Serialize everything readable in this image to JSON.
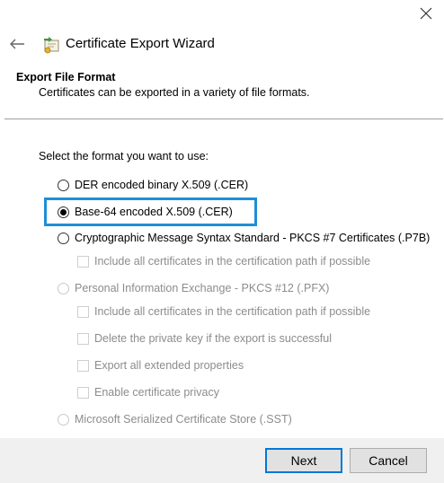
{
  "window": {
    "title": "Certificate Export Wizard",
    "close_icon": "close-icon",
    "back_icon": "back-arrow-icon",
    "wizard_icon": "certificate-wizard-icon"
  },
  "page": {
    "heading": "Export File Format",
    "description": "Certificates can be exported in a variety of file formats.",
    "prompt": "Select the format you want to use:"
  },
  "formats": [
    {
      "label": "DER encoded binary X.509 (.CER)",
      "selected": false,
      "enabled": true
    },
    {
      "label": "Base-64 encoded X.509 (.CER)",
      "selected": true,
      "enabled": true
    },
    {
      "label": "Cryptographic Message Syntax Standard - PKCS #7 Certificates (.P7B)",
      "selected": false,
      "enabled": true
    },
    {
      "label": "Personal Information Exchange - PKCS #12 (.PFX)",
      "selected": false,
      "enabled": false
    },
    {
      "label": "Microsoft Serialized Certificate Store (.SST)",
      "selected": false,
      "enabled": false
    }
  ],
  "pkcs7_options": [
    {
      "label": "Include all certificates in the certification path if possible",
      "checked": false,
      "enabled": false
    }
  ],
  "pfx_options": [
    {
      "label": "Include all certificates in the certification path if possible",
      "checked": false,
      "enabled": false
    },
    {
      "label": "Delete the private key if the export is successful",
      "checked": false,
      "enabled": false
    },
    {
      "label": "Export all extended properties",
      "checked": false,
      "enabled": false
    },
    {
      "label": "Enable certificate privacy",
      "checked": false,
      "enabled": false
    }
  ],
  "buttons": {
    "next": "Next",
    "cancel": "Cancel"
  },
  "colors": {
    "highlight": "#1e8fd6",
    "primary_button_border": "#0078d7",
    "footer_bg": "#f0f0f0",
    "disabled_text": "#8c8c8c"
  }
}
